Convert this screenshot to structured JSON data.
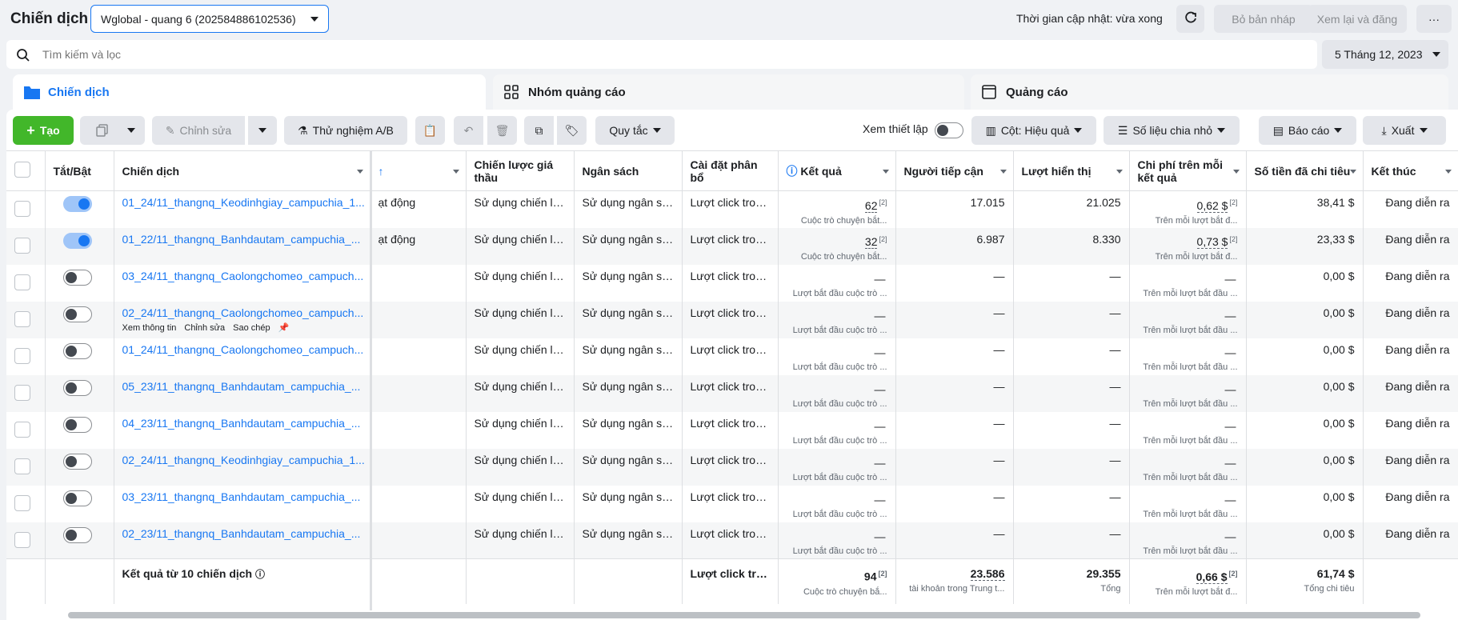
{
  "header": {
    "title": "Chiến dịch",
    "account": "Wglobal - quang 6 (202584886102536)",
    "update_text": "Thời gian cập nhật: vừa xong",
    "discard_label": "Bỏ bản nháp",
    "review_label": "Xem lại và đăng",
    "more_label": "···"
  },
  "search": {
    "placeholder": "Tìm kiếm và lọc",
    "date": "5 Tháng 12, 2023"
  },
  "tabs": [
    {
      "label": "Chiến dịch"
    },
    {
      "label": "Nhóm quảng cáo"
    },
    {
      "label": "Quảng cáo"
    }
  ],
  "toolbar": {
    "create_label": "Tạo",
    "edit_label": "Chỉnh sửa",
    "ab_label": "Thử nghiệm A/B",
    "rules_label": "Quy tắc",
    "view_setup_label": "Xem thiết lập",
    "columns_label": "Cột: Hiệu quả",
    "breakdown_label": "Số liệu chia nhỏ",
    "reports_label": "Báo cáo",
    "export_label": "Xuất"
  },
  "columns": {
    "toggle": "Tắt/Bật",
    "campaign": "Chiến dịch",
    "delivery": "↑",
    "bid": "Chiến lược giá thầu",
    "budget": "Ngân sách",
    "attribution": "Cài đặt phân bổ",
    "results": "Kết quả",
    "reach": "Người tiếp cận",
    "impressions": "Lượt hiển thị",
    "cost_per_result": "Chi phí trên mỗi kết quả",
    "spent": "Số tiền đã chi tiêu",
    "ends": "Kết thúc"
  },
  "rows": [
    {
      "on": true,
      "name": "01_24/11_thangnq_Keodinhgiay_campuchia_1...",
      "delivery": "ạt động",
      "bid": "Sử dụng chiến lư...",
      "budget": "Sử dụng ngân sá...",
      "attribution": "Lượt click tron...",
      "results": "62",
      "results_note": "[2]",
      "results_sub": "Cuộc trò chuyện bắt...",
      "reach": "17.015",
      "impressions": "21.025",
      "cpr": "0,62 $",
      "cpr_note": "[2]",
      "cpr_sub": "Trên mỗi lượt bắt đ...",
      "spent": "38,41 $",
      "ends": "Đang diễn ra"
    },
    {
      "on": true,
      "name": "01_22/11_thangnq_Banhdautam_campuchia_...",
      "delivery": "ạt động",
      "bid": "Sử dụng chiến lư...",
      "budget": "Sử dụng ngân sá...",
      "attribution": "Lượt click tron...",
      "results": "32",
      "results_note": "[2]",
      "results_sub": "Cuộc trò chuyện bắt...",
      "reach": "6.987",
      "impressions": "8.330",
      "cpr": "0,73 $",
      "cpr_note": "[2]",
      "cpr_sub": "Trên mỗi lượt bắt đ...",
      "spent": "23,33 $",
      "ends": "Đang diễn ra"
    },
    {
      "on": false,
      "name": "03_24/11_thangnq_Caolongchomeo_campuch...",
      "delivery": "",
      "bid": "Sử dụng chiến lư...",
      "budget": "Sử dụng ngân sá...",
      "attribution": "Lượt click tron...",
      "results": "—",
      "results_note": "",
      "results_sub": "Lượt bắt đầu cuộc trò ...",
      "reach": "—",
      "impressions": "—",
      "cpr": "—",
      "cpr_note": "",
      "cpr_sub": "Trên mỗi lượt bắt đầu ...",
      "spent": "0,00 $",
      "ends": "Đang diễn ra"
    },
    {
      "on": false,
      "name": "02_24/11_thangnq_Caolongchomeo_campuch...",
      "delivery": "",
      "bid": "Sử dụng chiến lư...",
      "budget": "Sử dụng ngân sá...",
      "attribution": "Lượt click tron...",
      "results": "—",
      "results_note": "",
      "results_sub": "Lượt bắt đầu cuộc trò ...",
      "reach": "—",
      "impressions": "—",
      "cpr": "—",
      "cpr_note": "",
      "cpr_sub": "Trên mỗi lượt bắt đầu ...",
      "spent": "0,00 $",
      "ends": "Đang diễn ra"
    },
    {
      "on": false,
      "name": "01_24/11_thangnq_Caolongchomeo_campuch...",
      "delivery": "",
      "bid": "Sử dụng chiến lư...",
      "budget": "Sử dụng ngân sá...",
      "attribution": "Lượt click tron...",
      "results": "—",
      "results_note": "",
      "results_sub": "Lượt bắt đầu cuộc trò ...",
      "reach": "—",
      "impressions": "—",
      "cpr": "—",
      "cpr_note": "",
      "cpr_sub": "Trên mỗi lượt bắt đầu ...",
      "spent": "0,00 $",
      "ends": "Đang diễn ra"
    },
    {
      "on": false,
      "name": "05_23/11_thangnq_Banhdautam_campuchia_...",
      "delivery": "",
      "bid": "Sử dụng chiến lư...",
      "budget": "Sử dụng ngân sá...",
      "attribution": "Lượt click tron...",
      "results": "—",
      "results_note": "",
      "results_sub": "Lượt bắt đầu cuộc trò ...",
      "reach": "—",
      "impressions": "—",
      "cpr": "—",
      "cpr_note": "",
      "cpr_sub": "Trên mỗi lượt bắt đầu ...",
      "spent": "0,00 $",
      "ends": "Đang diễn ra"
    },
    {
      "on": false,
      "name": "04_23/11_thangnq_Banhdautam_campuchia_...",
      "delivery": "",
      "bid": "Sử dụng chiến lư...",
      "budget": "Sử dụng ngân sá...",
      "attribution": "Lượt click tron...",
      "results": "—",
      "results_note": "",
      "results_sub": "Lượt bắt đầu cuộc trò ...",
      "reach": "—",
      "impressions": "—",
      "cpr": "—",
      "cpr_note": "",
      "cpr_sub": "Trên mỗi lượt bắt đầu ...",
      "spent": "0,00 $",
      "ends": "Đang diễn ra"
    },
    {
      "on": false,
      "name": "02_24/11_thangnq_Keodinhgiay_campuchia_1...",
      "delivery": "",
      "bid": "Sử dụng chiến lư...",
      "budget": "Sử dụng ngân sá...",
      "attribution": "Lượt click tron...",
      "results": "—",
      "results_note": "",
      "results_sub": "Lượt bắt đầu cuộc trò ...",
      "reach": "—",
      "impressions": "—",
      "cpr": "—",
      "cpr_note": "",
      "cpr_sub": "Trên mỗi lượt bắt đầu ...",
      "spent": "0,00 $",
      "ends": "Đang diễn ra"
    },
    {
      "on": false,
      "name": "03_23/11_thangnq_Banhdautam_campuchia_...",
      "delivery": "",
      "bid": "Sử dụng chiến lư...",
      "budget": "Sử dụng ngân sá...",
      "attribution": "Lượt click tron...",
      "results": "—",
      "results_note": "",
      "results_sub": "Lượt bắt đầu cuộc trò ...",
      "reach": "—",
      "impressions": "—",
      "cpr": "—",
      "cpr_note": "",
      "cpr_sub": "Trên mỗi lượt bắt đầu ...",
      "spent": "0,00 $",
      "ends": "Đang diễn ra"
    },
    {
      "on": false,
      "name": "02_23/11_thangnq_Banhdautam_campuchia_...",
      "delivery": "",
      "bid": "Sử dụng chiến lư...",
      "budget": "Sử dụng ngân sá...",
      "attribution": "Lượt click tron...",
      "results": "—",
      "results_note": "",
      "results_sub": "Lượt bắt đầu cuộc trò ...",
      "reach": "—",
      "impressions": "—",
      "cpr": "—",
      "cpr_note": "",
      "cpr_sub": "Trên mỗi lượt bắt đầu ...",
      "spent": "0,00 $",
      "ends": "Đang diễn ra"
    }
  ],
  "hover_actions": {
    "row": 3,
    "view": "Xem thông tin",
    "edit": "Chỉnh sửa",
    "copy": "Sao chép"
  },
  "totals": {
    "label": "Kết quả từ 10 chiến dịch",
    "attribution": "Lượt click tro...",
    "results": "94",
    "results_note": "[2]",
    "results_sub": "Cuộc trò chuyện bắ...",
    "reach": "23.586",
    "reach_sub": "tài khoản trong Trung t...",
    "impressions": "29.355",
    "impressions_sub": "Tổng",
    "cpr": "0,66 $",
    "cpr_note": "[2]",
    "cpr_sub": "Trên mỗi lượt bắt đ...",
    "spent": "61,74 $",
    "spent_sub": "Tổng chi tiêu"
  },
  "colors": {
    "accent": "#1877f2",
    "create": "#42b72a"
  }
}
